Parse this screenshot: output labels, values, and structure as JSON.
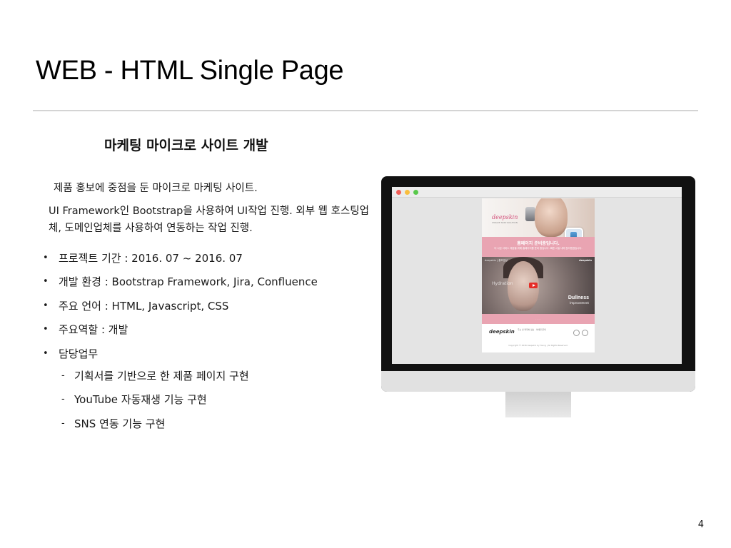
{
  "slide": {
    "title": "WEB - HTML Single Page",
    "subtitle": "마케팅 마이크로 사이트 개발",
    "intro": [
      "제품 홍보에 중점을 둔 마이크로 마케팅 사이트.",
      "UI Framework인 Bootstrap을 사용하여 UI작업 진행. 외부 웹 호스팅업체, 도메인업체를 사용하여 연동하는 작업 진행."
    ],
    "bullets": [
      "프로젝트 기간 : 2016. 07 ~ 2016. 07",
      "개발 환경 : Bootstrap Framework, Jira, Confluence",
      "주요 언어 : HTML, Javascript, CSS",
      "주요역할 : 개발",
      "담당업무"
    ],
    "sub_bullets": [
      "기획서를 기반으로 한 제품 페이지 구현",
      "YouTube 자동재생 기능 구현",
      "SNS 연동 기능 구현"
    ],
    "page_number": "4"
  },
  "mockup": {
    "brand": "deepskin",
    "brand_tagline": "UNIQUE SKIN SOLUTION",
    "pink_title": "홈페이지 준비중입니다.",
    "pink_text": "더 나은 서비스 제공을 위해 홈페이지를 준비 중입니다. 빠른 시일 내에 찾아뵙겠습니다.",
    "video_title": "deepskin | 홍보영상",
    "video_brand": "deepskin",
    "hydration": "Hydration",
    "dullness": "Dullness",
    "improvement": "Improvement",
    "pink_bar_text": "· · · · ·",
    "footer_brand": "deepskin",
    "footer_text": "주소 및 연락처 정보 · 이메일 문의",
    "copyright": "Copyright © 2016 deepskin by Young | All Rights Reserved."
  },
  "colors": {
    "pink": "#e9a4b2",
    "brand_pink": "#d24d78",
    "play_red": "#e52d27"
  }
}
